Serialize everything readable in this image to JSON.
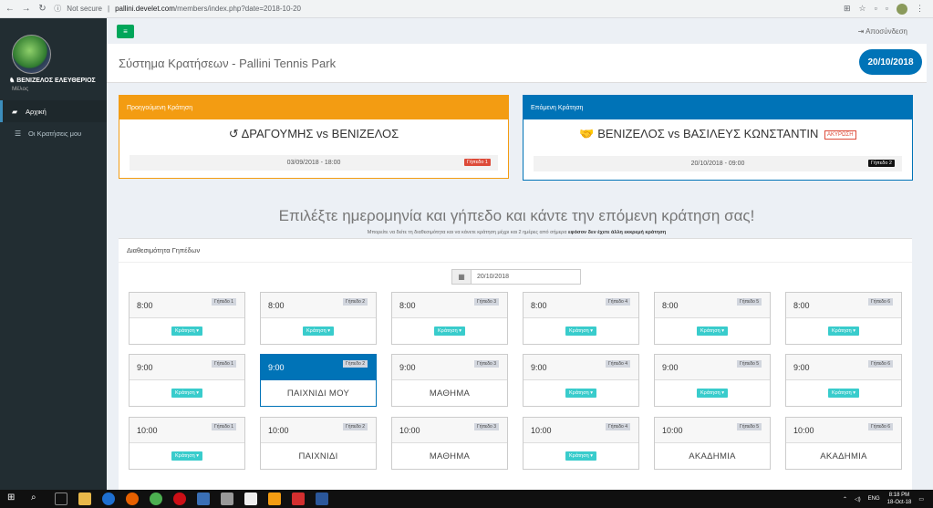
{
  "browser": {
    "secure_label": "Not secure",
    "url_host": "pallini.develet.com",
    "url_path": "/members/index.php?date=2018-10-20"
  },
  "sidebar": {
    "user_name": "♞ ΒΕΝΙΖΕΛΟΣ ΕΛΕΥΘΕΡΙΟΣ",
    "user_role": "Μέλος",
    "items": [
      {
        "label": "Αρχική",
        "icon": "home-icon"
      },
      {
        "label": "Οι Κρατήσεις μου",
        "icon": "list-icon"
      }
    ]
  },
  "topbar": {
    "logout_label": "Αποσύνδεση"
  },
  "header": {
    "title": "Σύστημα Κρατήσεων - Pallini Tennis Park",
    "date_badge": "20/10/2018"
  },
  "previous": {
    "title": "Προηγούμενη Κράτηση",
    "matchup": "ΔΡΑΓΟΥΜΗΣ vs ΒΕΝΙΖΕΛΟΣ",
    "datetime": "03/09/2018  -  18:00",
    "court": "Γήπεδο 1",
    "color": "#f39c12"
  },
  "next": {
    "title": "Επόμενη Κράτηση",
    "matchup": "ΒΕΝΙΖΕΛΟΣ vs ΒΑΣΙΛΕΥΣ ΚΩΝΣΤΑΝΤΙΝ",
    "cancel_label": "ΑΚΥΡΩΣΗ",
    "datetime": "20/10/2018  -  09:00",
    "court": "Γήπεδο 2",
    "color": "#0073b7"
  },
  "main": {
    "heading": "Επιλέξτε ημερομηνία και γήπεδο και κάντε την επόμενη κράτηση σας!",
    "subheading": "Μπορείτε να δείτε τη διαθεσιμότητα και να κάνετε κράτηση μέχρι και 2 ημέρες από σήμερα",
    "subheading_bold": "εφόσον δεν έχετε άλλη εκκρεμή κράτηση",
    "availability_title": "Διαθεσιμότητα Γηπέδων",
    "date_value": "20/10/2018"
  },
  "slots": {
    "book_label": "Κράτηση ▾",
    "rows": [
      {
        "time": "8:00",
        "cells": [
          {
            "court": "Γήπεδο 1",
            "status": "book",
            "label": ""
          },
          {
            "court": "Γήπεδο 2",
            "status": "book",
            "label": ""
          },
          {
            "court": "Γήπεδο 3",
            "status": "book",
            "label": ""
          },
          {
            "court": "Γήπεδο 4",
            "status": "book",
            "label": ""
          },
          {
            "court": "Γήπεδο 5",
            "status": "book",
            "label": ""
          },
          {
            "court": "Γήπεδο 6",
            "status": "book",
            "label": ""
          }
        ]
      },
      {
        "time": "9:00",
        "cells": [
          {
            "court": "Γήπεδο 1",
            "status": "book",
            "label": ""
          },
          {
            "court": "Γήπεδο 2",
            "status": "mine",
            "label": "ΠΑΙΧΝΙΔΙ ΜΟΥ"
          },
          {
            "court": "Γήπεδο 3",
            "status": "taken",
            "label": "ΜΑΘΗΜΑ"
          },
          {
            "court": "Γήπεδο 4",
            "status": "book",
            "label": ""
          },
          {
            "court": "Γήπεδο 5",
            "status": "book",
            "label": ""
          },
          {
            "court": "Γήπεδο 6",
            "status": "book",
            "label": ""
          }
        ]
      },
      {
        "time": "10:00",
        "cells": [
          {
            "court": "Γήπεδο 1",
            "status": "book",
            "label": ""
          },
          {
            "court": "Γήπεδο 2",
            "status": "taken",
            "label": "ΠΑΙΧΝΙΔΙ"
          },
          {
            "court": "Γήπεδο 3",
            "status": "taken",
            "label": "ΜΑΘΗΜΑ"
          },
          {
            "court": "Γήπεδο 4",
            "status": "book",
            "label": ""
          },
          {
            "court": "Γήπεδο 5",
            "status": "taken",
            "label": "ΑΚΑΔΗΜΙΑ"
          },
          {
            "court": "Γήπεδο 6",
            "status": "taken",
            "label": "ΑΚΑΔΗΜΙΑ"
          }
        ]
      }
    ]
  },
  "taskbar": {
    "lang": "ENG",
    "time": "8:18 PM",
    "date": "18-Oct-18"
  }
}
